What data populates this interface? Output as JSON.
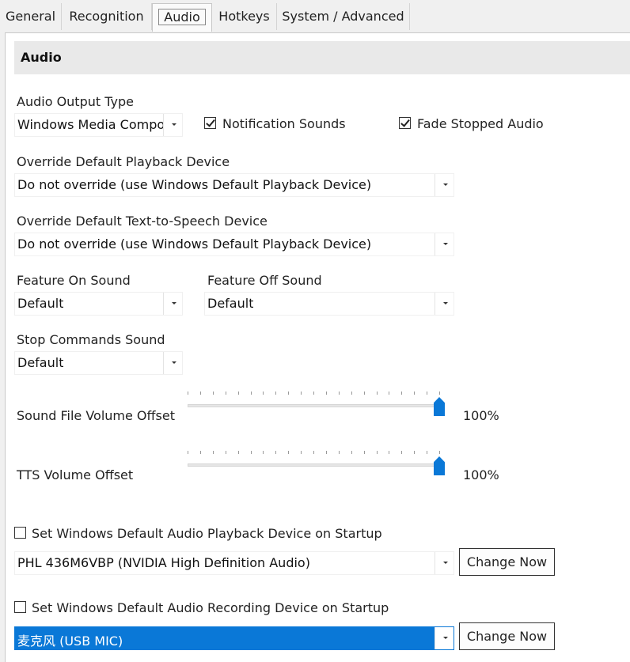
{
  "tabs": [
    "General",
    "Recognition",
    "Audio",
    "Hotkeys",
    "System / Advanced"
  ],
  "section_title": "Audio",
  "audio_output": {
    "label": "Audio Output Type",
    "value": "Windows Media Compo"
  },
  "notification_sounds": {
    "label": "Notification Sounds",
    "checked": true
  },
  "fade_stopped_audio": {
    "label": "Fade Stopped Audio",
    "checked": true
  },
  "playback_override": {
    "label": "Override Default Playback Device",
    "value": "Do not override (use Windows Default Playback Device)"
  },
  "tts_override": {
    "label": "Override Default Text-to-Speech Device",
    "value": "Do not override (use Windows Default Playback Device)"
  },
  "feature_on": {
    "label": "Feature On Sound",
    "value": "Default"
  },
  "feature_off": {
    "label": "Feature Off Sound",
    "value": "Default"
  },
  "stop_commands": {
    "label": "Stop Commands Sound",
    "value": "Default"
  },
  "sound_file_volume": {
    "label": "Sound File Volume Offset",
    "value_text": "100%",
    "level": 1.0
  },
  "tts_volume": {
    "label": "TTS Volume Offset",
    "value_text": "100%",
    "level": 1.0
  },
  "playback_startup": {
    "label": "Set Windows Default Audio Playback Device on Startup",
    "checked": false,
    "device": "PHL 436M6VBP (NVIDIA High Definition Audio)",
    "button": "Change Now"
  },
  "recording_startup": {
    "label": "Set Windows Default Audio Recording Device on Startup",
    "checked": false,
    "device": "麦克风 (USB MIC)",
    "button": "Change Now"
  },
  "colors": {
    "accent": "#0a78d7",
    "header_bg": "#e9e9e9",
    "window_bg": "#f0f0f0"
  }
}
